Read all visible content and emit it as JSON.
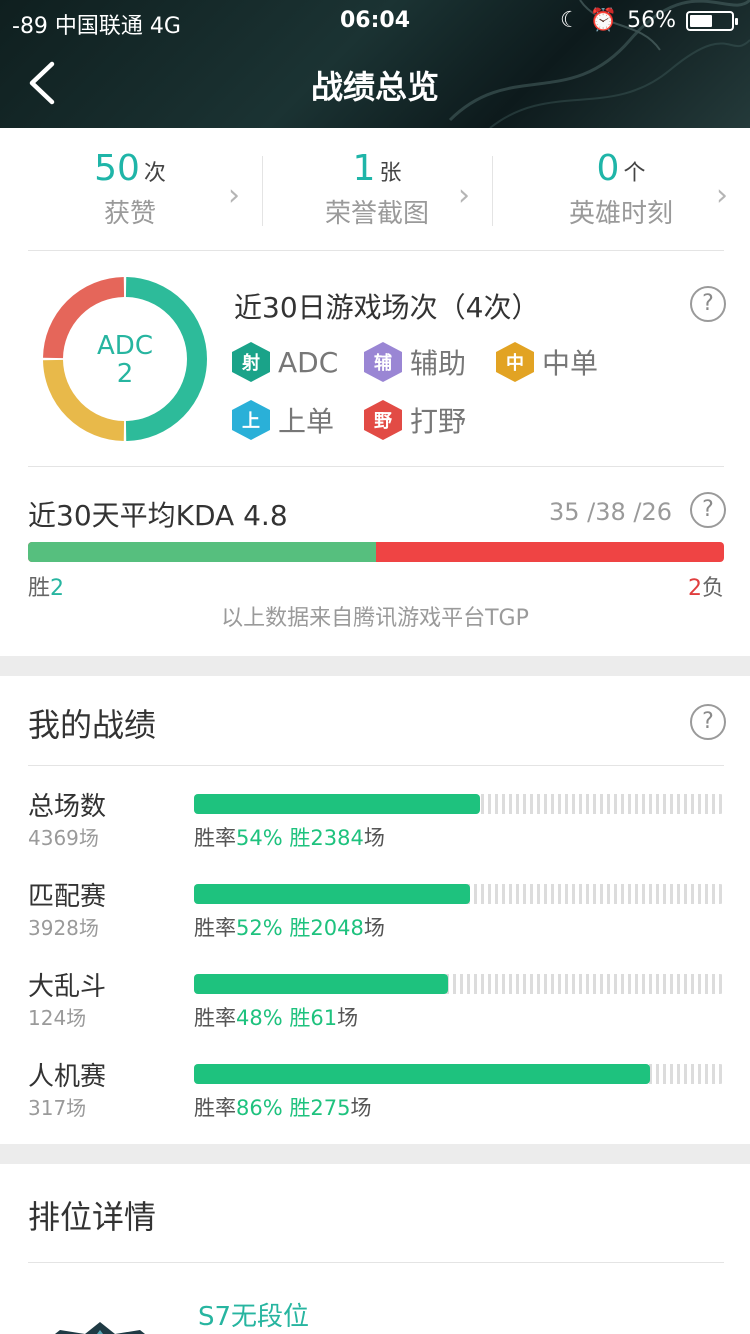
{
  "status_bar": {
    "left": "-89 中国联通   4G",
    "time": "06:04",
    "battery": "56%",
    "battery_level": 0.56
  },
  "header": {
    "title": "战绩总览"
  },
  "summary": [
    {
      "value": "50",
      "unit": "次",
      "label": "获赞"
    },
    {
      "value": "1",
      "unit": "张",
      "label": "荣誉截图"
    },
    {
      "value": "0",
      "unit": "个",
      "label": "英雄时刻"
    }
  ],
  "recent": {
    "title": "近30日游戏场次（4次）",
    "donut_label": "ADC",
    "donut_value": "2",
    "donut_segments": [
      {
        "role": "ADC",
        "value": 2,
        "color": "#2dbb9a"
      },
      {
        "role": "辅助",
        "value": 1,
        "color": "#e8b94a"
      },
      {
        "role": "中单",
        "value": 1,
        "color": "#e5665a"
      }
    ],
    "roles": [
      {
        "icon": "射",
        "label": "ADC",
        "color": "#1aa389"
      },
      {
        "icon": "辅",
        "label": "辅助",
        "color": "#9a86d4"
      },
      {
        "icon": "中",
        "label": "中单",
        "color": "#e2a323"
      },
      {
        "icon": "上",
        "label": "上单",
        "color": "#2ab0d8"
      },
      {
        "icon": "野",
        "label": "打野",
        "color": "#e24b45"
      }
    ]
  },
  "kda": {
    "title": "近30天平均KDA 4.8",
    "stats": "35 /38 /26",
    "win_label": "胜",
    "wins": "2",
    "lose_label": "负",
    "losses": "2",
    "win_fraction": 0.5,
    "source": "以上数据来自腾讯游戏平台TGP"
  },
  "my_records": {
    "title": "我的战绩",
    "rate_prefix": "胜率",
    "win_prefix": "胜",
    "unit": "场",
    "rows": [
      {
        "name": "总场数",
        "count": "4369场",
        "rate": "54%",
        "wins": "2384",
        "fraction": 0.54
      },
      {
        "name": "匹配赛",
        "count": "3928场",
        "rate": "52%",
        "wins": "2048",
        "fraction": 0.52
      },
      {
        "name": "大乱斗",
        "count": "124场",
        "rate": "48%",
        "wins": "61",
        "fraction": 0.48
      },
      {
        "name": "人机赛",
        "count": "317场",
        "rate": "86%",
        "wins": "275",
        "fraction": 0.86
      }
    ]
  },
  "rank": {
    "title": "排位详情",
    "season": "S7无段位"
  },
  "icons": {
    "back": "chevron-left-icon",
    "help": "question-circle-icon",
    "more": "chevron-right-icon"
  }
}
